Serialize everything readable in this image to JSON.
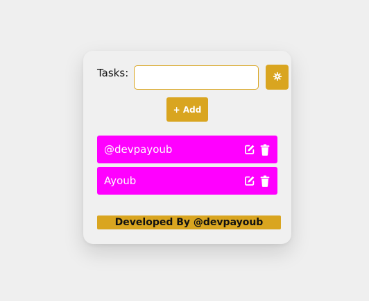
{
  "form": {
    "label": "Tasks:",
    "input_value": "",
    "input_placeholder": "",
    "add_label": "+ Add",
    "settings_icon": "gear-icon"
  },
  "tasks": [
    {
      "text": "@devpayoub",
      "edit_icon": "edit-icon",
      "delete_icon": "trash-icon"
    },
    {
      "text": "Ayoub",
      "edit_icon": "edit-icon",
      "delete_icon": "trash-icon"
    }
  ],
  "footer": {
    "text": "Developed By @devpayoub"
  },
  "colors": {
    "accent": "#d9a520",
    "task_bg": "#ff00ff",
    "background": "#efefef",
    "card": "#f0f0f0"
  }
}
